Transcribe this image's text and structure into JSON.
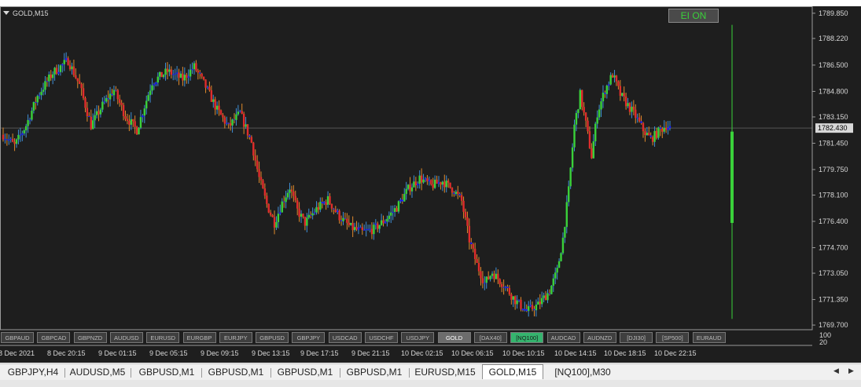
{
  "chart": {
    "title": "GOLD,M15",
    "ei_button": "EI ON",
    "current_price": "1782.430",
    "sub_window_labels": [
      "100",
      "20"
    ]
  },
  "symbol_buttons": [
    {
      "label": "GBPAUD",
      "state": "normal"
    },
    {
      "label": "GBPCAD",
      "state": "normal"
    },
    {
      "label": "GBPNZD",
      "state": "normal"
    },
    {
      "label": "AUDUSD",
      "state": "normal"
    },
    {
      "label": "EURUSD",
      "state": "normal"
    },
    {
      "label": "EURGBP",
      "state": "normal"
    },
    {
      "label": "EURJPY",
      "state": "normal"
    },
    {
      "label": "GBPUSD",
      "state": "normal"
    },
    {
      "label": "GBPJPY",
      "state": "normal"
    },
    {
      "label": "USDCAD",
      "state": "normal"
    },
    {
      "label": "USDCHF",
      "state": "normal"
    },
    {
      "label": "USDJPY",
      "state": "normal"
    },
    {
      "label": "GOLD",
      "state": "active"
    },
    {
      "label": "[DAX40]",
      "state": "normal"
    },
    {
      "label": "[NQ100]",
      "state": "green"
    },
    {
      "label": "AUDCAD",
      "state": "normal"
    },
    {
      "label": "AUDNZD",
      "state": "normal"
    },
    {
      "label": "[DJI30]",
      "state": "normal"
    },
    {
      "label": "[SP500]",
      "state": "normal"
    },
    {
      "label": "EURAUD",
      "state": "normal"
    }
  ],
  "tabs": [
    {
      "label": "GBPJPY,H4",
      "active": false
    },
    {
      "label": "AUDUSD,M5",
      "active": false
    },
    {
      "label": "GBPUSD,M1",
      "active": false
    },
    {
      "label": "GBPUSD,M1",
      "active": false
    },
    {
      "label": "GBPUSD,M1",
      "active": false
    },
    {
      "label": "GBPUSD,M1",
      "active": false
    },
    {
      "label": "EURUSD,M15",
      "active": false
    },
    {
      "label": "GOLD,M15",
      "active": true
    },
    {
      "label": "[NQ100],M30",
      "active": false
    }
  ],
  "colors": {
    "background": "#1e1e1e",
    "bull_candle": "#3ad13a",
    "bear_candle": "#e02c2c",
    "neutral_candle": "#1a1aff",
    "wick_up": "#3f8fd6",
    "wick_down": "#e08a2c",
    "axis_text": "#d8d8d8",
    "bid_line": "#555555"
  },
  "chart_data": {
    "type": "candlestick",
    "symbol": "GOLD",
    "timeframe": "M15",
    "y_ticks": [
      1789.85,
      1788.22,
      1786.5,
      1784.8,
      1783.15,
      1781.45,
      1779.75,
      1778.1,
      1776.4,
      1774.7,
      1773.05,
      1771.35,
      1769.7
    ],
    "y_tick_labels": [
      "1789.850",
      "1788.220",
      "1786.500",
      "1784.800",
      "1783.150",
      "1781.450",
      "1779.750",
      "1778.100",
      "1776.400",
      "1774.700",
      "1773.050",
      "1771.350",
      "1769.700"
    ],
    "ylim": [
      1769.4,
      1790.3
    ],
    "x_tick_labels": [
      "8 Dec 2021",
      "8 Dec 20:15",
      "9 Dec 01:15",
      "9 Dec 05:15",
      "9 Dec 09:15",
      "9 Dec 13:15",
      "9 Dec 17:15",
      "9 Dec 21:15",
      "10 Dec 02:15",
      "10 Dec 06:15",
      "10 Dec 10:15",
      "10 Dec 14:15",
      "10 Dec 18:15",
      "10 Dec 22:15"
    ],
    "current_price": 1782.43,
    "future_bar": {
      "low": 1770.1,
      "high": 1789.1,
      "open": 1776.3,
      "close": 1782.2
    },
    "close_path": [
      {
        "i": 0,
        "v": 1782.0
      },
      {
        "i": 6,
        "v": 1781.3
      },
      {
        "i": 12,
        "v": 1782.6
      },
      {
        "i": 18,
        "v": 1784.5
      },
      {
        "i": 26,
        "v": 1786.0
      },
      {
        "i": 34,
        "v": 1786.8
      },
      {
        "i": 40,
        "v": 1785.2
      },
      {
        "i": 46,
        "v": 1782.6
      },
      {
        "i": 52,
        "v": 1783.9
      },
      {
        "i": 58,
        "v": 1784.9
      },
      {
        "i": 64,
        "v": 1783.2
      },
      {
        "i": 70,
        "v": 1782.3
      },
      {
        "i": 78,
        "v": 1785.4
      },
      {
        "i": 86,
        "v": 1786.1
      },
      {
        "i": 94,
        "v": 1785.6
      },
      {
        "i": 100,
        "v": 1786.4
      },
      {
        "i": 106,
        "v": 1785.1
      },
      {
        "i": 112,
        "v": 1783.6
      },
      {
        "i": 118,
        "v": 1782.5
      },
      {
        "i": 124,
        "v": 1783.4
      },
      {
        "i": 130,
        "v": 1781.5
      },
      {
        "i": 134,
        "v": 1779.2
      },
      {
        "i": 138,
        "v": 1777.5
      },
      {
        "i": 142,
        "v": 1776.3
      },
      {
        "i": 146,
        "v": 1777.6
      },
      {
        "i": 150,
        "v": 1778.6
      },
      {
        "i": 154,
        "v": 1777.1
      },
      {
        "i": 158,
        "v": 1776.3
      },
      {
        "i": 164,
        "v": 1777.2
      },
      {
        "i": 170,
        "v": 1777.8
      },
      {
        "i": 176,
        "v": 1776.7
      },
      {
        "i": 182,
        "v": 1776.0
      },
      {
        "i": 188,
        "v": 1775.7
      },
      {
        "i": 194,
        "v": 1775.9
      },
      {
        "i": 200,
        "v": 1776.5
      },
      {
        "i": 206,
        "v": 1777.3
      },
      {
        "i": 212,
        "v": 1778.5
      },
      {
        "i": 218,
        "v": 1779.2
      },
      {
        "i": 224,
        "v": 1778.7
      },
      {
        "i": 230,
        "v": 1779.0
      },
      {
        "i": 236,
        "v": 1778.4
      },
      {
        "i": 240,
        "v": 1777.7
      },
      {
        "i": 244,
        "v": 1775.2
      },
      {
        "i": 248,
        "v": 1773.6
      },
      {
        "i": 252,
        "v": 1772.4
      },
      {
        "i": 256,
        "v": 1773.1
      },
      {
        "i": 262,
        "v": 1772.3
      },
      {
        "i": 268,
        "v": 1771.3
      },
      {
        "i": 274,
        "v": 1770.6
      },
      {
        "i": 280,
        "v": 1771.0
      },
      {
        "i": 286,
        "v": 1771.9
      },
      {
        "i": 290,
        "v": 1773.2
      },
      {
        "i": 293,
        "v": 1775.3
      },
      {
        "i": 296,
        "v": 1778.4
      },
      {
        "i": 299,
        "v": 1782.6
      },
      {
        "i": 302,
        "v": 1784.6
      },
      {
        "i": 305,
        "v": 1782.7
      },
      {
        "i": 308,
        "v": 1780.6
      },
      {
        "i": 311,
        "v": 1783.4
      },
      {
        "i": 315,
        "v": 1784.9
      },
      {
        "i": 319,
        "v": 1785.9
      },
      {
        "i": 323,
        "v": 1784.6
      },
      {
        "i": 327,
        "v": 1783.9
      },
      {
        "i": 331,
        "v": 1783.2
      },
      {
        "i": 335,
        "v": 1782.3
      },
      {
        "i": 339,
        "v": 1781.7
      },
      {
        "i": 343,
        "v": 1782.2
      },
      {
        "i": 347,
        "v": 1782.6
      },
      {
        "i": 349,
        "v": 1782.43
      }
    ]
  }
}
